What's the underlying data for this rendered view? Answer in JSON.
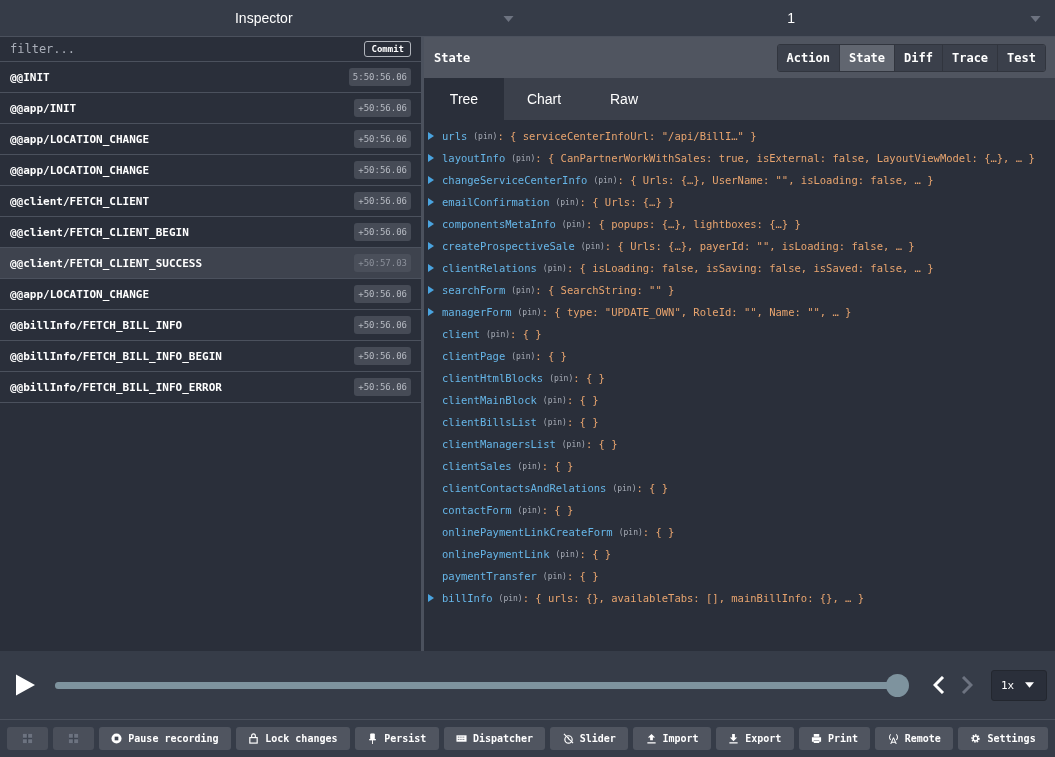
{
  "top_bar": {
    "monitor": "Inspector",
    "instance": "1"
  },
  "filter": {
    "placeholder": "filter...",
    "commit": "Commit"
  },
  "actions": [
    {
      "name": "@@INIT",
      "time": "5:50:56.06",
      "selected": false
    },
    {
      "name": "@@app/INIT",
      "time": "+50:56.06",
      "selected": false
    },
    {
      "name": "@@app/LOCATION_CHANGE",
      "time": "+50:56.06",
      "selected": false
    },
    {
      "name": "@@app/LOCATION_CHANGE",
      "time": "+50:56.06",
      "selected": false
    },
    {
      "name": "@@client/FETCH_CLIENT",
      "time": "+50:56.06",
      "selected": false
    },
    {
      "name": "@@client/FETCH_CLIENT_BEGIN",
      "time": "+50:56.06",
      "selected": false
    },
    {
      "name": "@@client/FETCH_CLIENT_SUCCESS",
      "time": "+50:57.03",
      "selected": true
    },
    {
      "name": "@@app/LOCATION_CHANGE",
      "time": "+50:56.06",
      "selected": false
    },
    {
      "name": "@@billInfo/FETCH_BILL_INFO",
      "time": "+50:56.06",
      "selected": false
    },
    {
      "name": "@@billInfo/FETCH_BILL_INFO_BEGIN",
      "time": "+50:56.06",
      "selected": false
    },
    {
      "name": "@@billInfo/FETCH_BILL_INFO_ERROR",
      "time": "+50:56.06",
      "selected": false
    }
  ],
  "panel": {
    "title": "State",
    "tabs": [
      {
        "label": "Action",
        "selected": false
      },
      {
        "label": "State",
        "selected": true
      },
      {
        "label": "Diff",
        "selected": false
      },
      {
        "label": "Trace",
        "selected": false
      },
      {
        "label": "Test",
        "selected": false
      }
    ],
    "view_tabs": [
      {
        "label": "Tree",
        "selected": true
      },
      {
        "label": "Chart",
        "selected": false
      },
      {
        "label": "Raw",
        "selected": false
      }
    ]
  },
  "tree": [
    {
      "key": "urls",
      "pin": "(pin)",
      "value": ": { serviceCenterInfoUrl: \"/api/BillI…\" }",
      "expandable": true
    },
    {
      "key": "layoutInfo",
      "pin": "(pin)",
      "value": ": { CanPartnerWorkWithSales: true, isExternal: false, LayoutViewModel: {…}, … }",
      "expandable": true
    },
    {
      "key": "changeServiceCenterInfo",
      "pin": "(pin)",
      "value": ": { Urls: {…}, UserName: \"\", isLoading: false, … }",
      "expandable": true
    },
    {
      "key": "emailConfirmation",
      "pin": "(pin)",
      "value": ": { Urls: {…} }",
      "expandable": true
    },
    {
      "key": "componentsMetaInfo",
      "pin": "(pin)",
      "value": ": { popups: {…}, lightboxes: {…} }",
      "expandable": true
    },
    {
      "key": "createProspectiveSale",
      "pin": "(pin)",
      "value": ": { Urls: {…}, payerId: \"\", isLoading: false, … }",
      "expandable": true
    },
    {
      "key": "clientRelations",
      "pin": "(pin)",
      "value": ": { isLoading: false, isSaving: false, isSaved: false, … }",
      "expandable": true
    },
    {
      "key": "searchForm",
      "pin": "(pin)",
      "value": ": { SearchString: \"\" }",
      "expandable": true
    },
    {
      "key": "managerForm",
      "pin": "(pin)",
      "value": ": { type: \"UPDATE_OWN\", RoleId: \"\", Name: \"\", … }",
      "expandable": true
    },
    {
      "key": "client",
      "pin": "(pin)",
      "value": ": { }",
      "expandable": false
    },
    {
      "key": "clientPage",
      "pin": "(pin)",
      "value": ": { }",
      "expandable": false
    },
    {
      "key": "clientHtmlBlocks",
      "pin": "(pin)",
      "value": ": { }",
      "expandable": false
    },
    {
      "key": "clientMainBlock",
      "pin": "(pin)",
      "value": ": { }",
      "expandable": false
    },
    {
      "key": "clientBillsList",
      "pin": "(pin)",
      "value": ": { }",
      "expandable": false
    },
    {
      "key": "clientManagersList",
      "pin": "(pin)",
      "value": ": { }",
      "expandable": false
    },
    {
      "key": "clientSales",
      "pin": "(pin)",
      "value": ": { }",
      "expandable": false
    },
    {
      "key": "clientContactsAndRelations",
      "pin": "(pin)",
      "value": ": { }",
      "expandable": false
    },
    {
      "key": "contactForm",
      "pin": "(pin)",
      "value": ": { }",
      "expandable": false
    },
    {
      "key": "onlinePaymentLinkCreateForm",
      "pin": "(pin)",
      "value": ": { }",
      "expandable": false
    },
    {
      "key": "onlinePaymentLink",
      "pin": "(pin)",
      "value": ": { }",
      "expandable": false
    },
    {
      "key": "paymentTransfer",
      "pin": "(pin)",
      "value": ": { }",
      "expandable": false
    },
    {
      "key": "billInfo",
      "pin": "(pin)",
      "value": ": { urls: {}, availableTabs: [], mainBillInfo: {}, … }",
      "expandable": true
    }
  ],
  "player": {
    "level": 1.0,
    "prev_disabled": false,
    "next_disabled": true,
    "speed": "1x"
  },
  "toolbar": [
    {
      "kind": "layout-left"
    },
    {
      "kind": "layout-bottom"
    },
    {
      "label": "Pause recording",
      "kind": "pause"
    },
    {
      "label": "Lock changes",
      "kind": "lock"
    },
    {
      "label": "Persist",
      "kind": "pin"
    },
    {
      "label": "Dispatcher",
      "kind": "keyboard"
    },
    {
      "label": "Slider",
      "kind": "timer"
    },
    {
      "label": "Import",
      "kind": "upload"
    },
    {
      "label": "Export",
      "kind": "download"
    },
    {
      "label": "Print",
      "kind": "print"
    },
    {
      "label": "Remote",
      "kind": "antenna"
    },
    {
      "label": "Settings",
      "kind": "gear"
    }
  ]
}
